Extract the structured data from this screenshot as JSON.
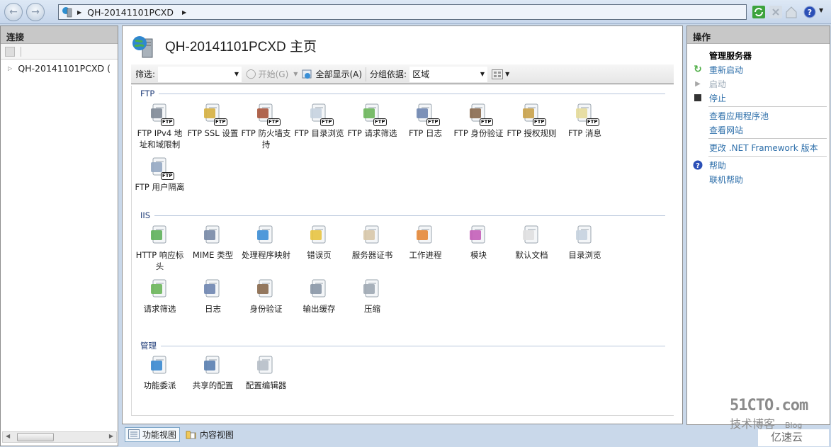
{
  "address_bar": {
    "root_label": "QH-20141101PCXD"
  },
  "connections": {
    "header": "连接",
    "tree_item": "QH-20141101PCXD ("
  },
  "page": {
    "title": "QH-20141101PCXD 主页"
  },
  "filter_bar": {
    "filter_label": "筛选:",
    "filter_value": "",
    "start_label": "开始(G)",
    "show_all_label": "全部显示(A)",
    "group_by_label": "分组依据:",
    "group_by_value": "区域"
  },
  "groups": [
    {
      "name": "FTP",
      "items": [
        {
          "label": "FTP IPv4 地址和域限制",
          "icon": "ip-restriction-icon"
        },
        {
          "label": "FTP SSL 设置",
          "icon": "lock-icon"
        },
        {
          "label": "FTP 防火墙支持",
          "icon": "firewall-icon"
        },
        {
          "label": "FTP 目录浏览",
          "icon": "directory-browse-icon"
        },
        {
          "label": "FTP 请求筛选",
          "icon": "request-filter-icon"
        },
        {
          "label": "FTP 日志",
          "icon": "log-icon"
        },
        {
          "label": "FTP 身份验证",
          "icon": "authentication-icon"
        },
        {
          "label": "FTP 授权规则",
          "icon": "keys-icon"
        },
        {
          "label": "FTP 消息",
          "icon": "message-icon"
        },
        {
          "label": "FTP 用户隔离",
          "icon": "user-isolation-icon"
        }
      ]
    },
    {
      "name": "IIS",
      "items": [
        {
          "label": "HTTP 响应标头",
          "icon": "http-headers-icon"
        },
        {
          "label": "MIME 类型",
          "icon": "mime-icon"
        },
        {
          "label": "处理程序映射",
          "icon": "handler-mapping-icon"
        },
        {
          "label": "错误页",
          "icon": "error-page-icon"
        },
        {
          "label": "服务器证书",
          "icon": "certificate-icon"
        },
        {
          "label": "工作进程",
          "icon": "worker-process-icon"
        },
        {
          "label": "模块",
          "icon": "modules-icon"
        },
        {
          "label": "默认文档",
          "icon": "default-document-icon"
        },
        {
          "label": "目录浏览",
          "icon": "directory-browse-icon"
        },
        {
          "label": "请求筛选",
          "icon": "request-filter-icon"
        },
        {
          "label": "日志",
          "icon": "log-icon"
        },
        {
          "label": "身份验证",
          "icon": "authentication-icon"
        },
        {
          "label": "输出缓存",
          "icon": "output-cache-icon"
        },
        {
          "label": "压缩",
          "icon": "compression-icon"
        }
      ]
    },
    {
      "name": "管理",
      "items": [
        {
          "label": "功能委派",
          "icon": "feature-delegation-icon"
        },
        {
          "label": "共享的配置",
          "icon": "shared-config-icon"
        },
        {
          "label": "配置编辑器",
          "icon": "config-editor-icon"
        }
      ]
    }
  ],
  "bottom_tabs": {
    "features_view": "功能视图",
    "content_view": "内容视图"
  },
  "actions": {
    "header": "操作",
    "section_title": "管理服务器",
    "restart": "重新启动",
    "start": "启动",
    "stop": "停止",
    "view_app_pools": "查看应用程序池",
    "view_sites": "查看网站",
    "change_framework": "更改 .NET Framework 版本",
    "help": "帮助",
    "online_help": "联机帮助"
  },
  "watermark": {
    "line1": "51CTO.com",
    "line2": "技术博客",
    "line3": "Blog",
    "line4": "亿速云"
  }
}
